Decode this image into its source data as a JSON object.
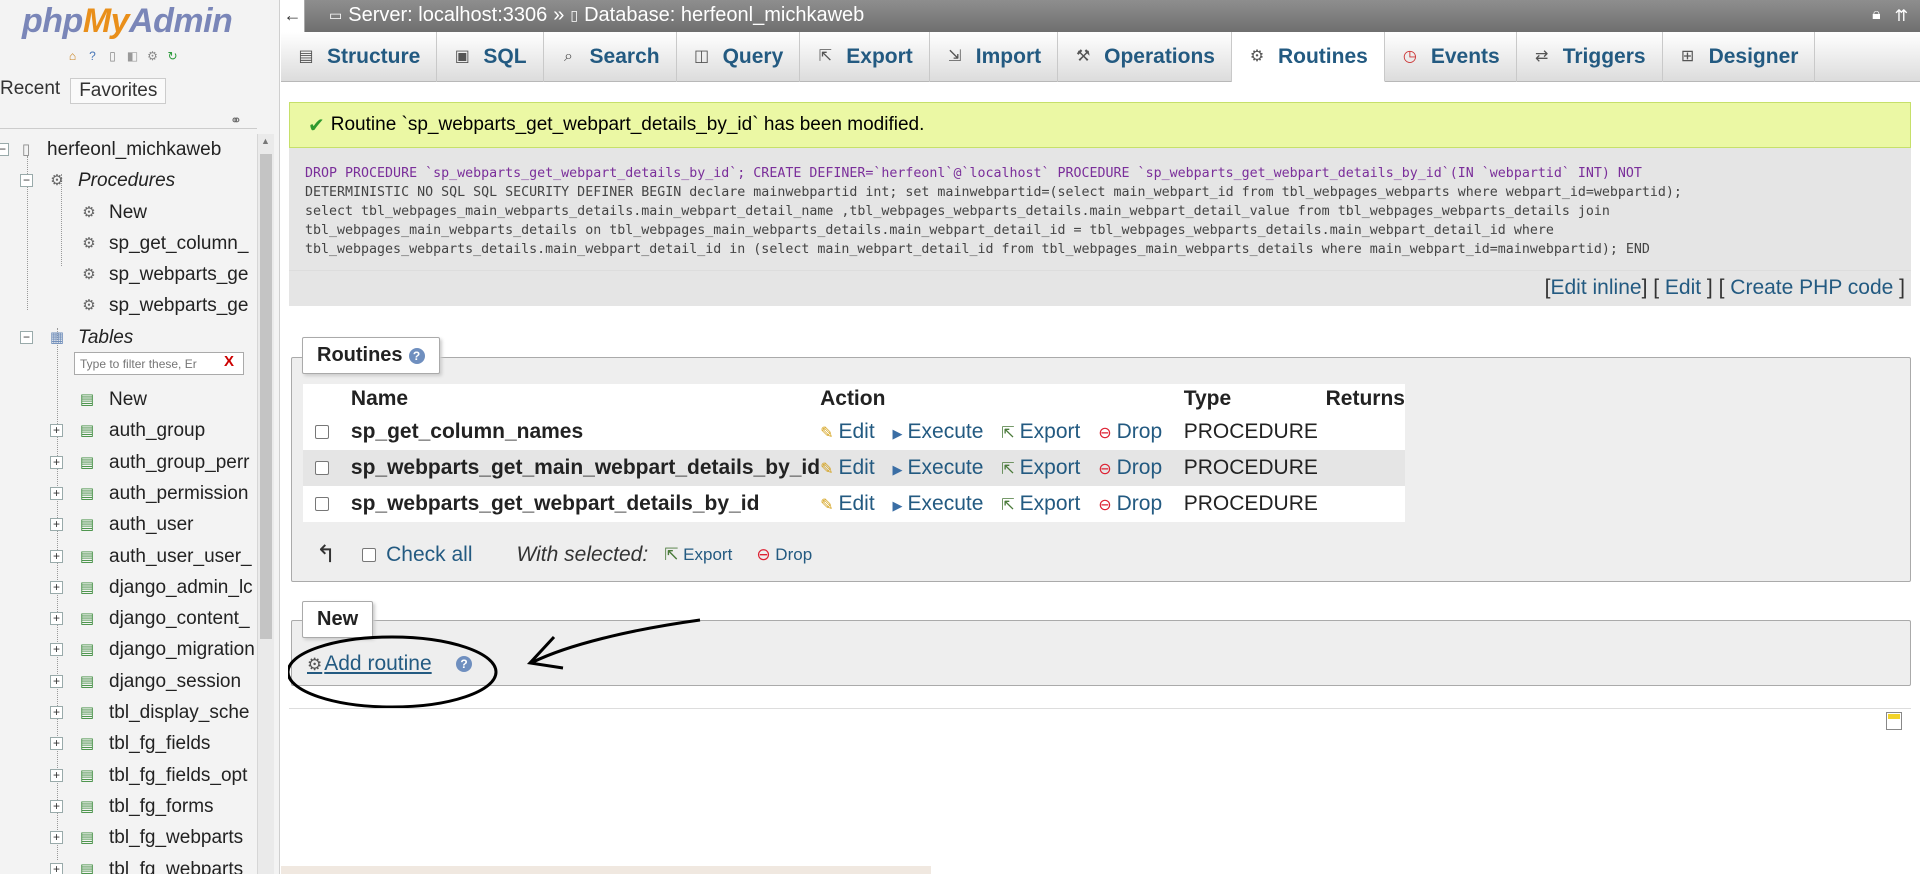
{
  "nav": {
    "logo": {
      "php": "php",
      "my": "My",
      "admin": "Admin"
    },
    "tabs": {
      "recent": "Recent",
      "favorites": "Favorites"
    },
    "db_name": "herfeonl_michkaweb",
    "procedures": {
      "label": "Procedures",
      "items": [
        "New",
        "sp_get_column_",
        "sp_webparts_ge",
        "sp_webparts_ge"
      ]
    },
    "tables": {
      "label": "Tables",
      "filter_placeholder": "Type to filter these, Er",
      "filter_clear": "X",
      "items": [
        "New",
        "auth_group",
        "auth_group_perr",
        "auth_permission",
        "auth_user",
        "auth_user_user_",
        "django_admin_lc",
        "django_content_",
        "django_migration",
        "django_session",
        "tbl_display_sche",
        "tbl_fg_fields",
        "tbl_fg_fields_opt",
        "tbl_fg_forms",
        "tbl_fg_webparts",
        "tbl_fg_webparts_"
      ]
    }
  },
  "topbar": {
    "server": "Server: localhost:3306",
    "sep": "»",
    "database": "Database: herfeonl_michkaweb"
  },
  "tabs": [
    {
      "label": "Structure",
      "icon": "structure-icon",
      "glyph": "▤"
    },
    {
      "label": "SQL",
      "icon": "sql-icon",
      "glyph": "▣"
    },
    {
      "label": "Search",
      "icon": "search-icon",
      "glyph": "⌕"
    },
    {
      "label": "Query",
      "icon": "query-icon",
      "glyph": "◫"
    },
    {
      "label": "Export",
      "icon": "export-icon",
      "glyph": "⇱"
    },
    {
      "label": "Import",
      "icon": "import-icon",
      "glyph": "⇲"
    },
    {
      "label": "Operations",
      "icon": "wrench-icon",
      "glyph": "⚒"
    },
    {
      "label": "Routines",
      "icon": "routines-icon",
      "glyph": "⚙"
    },
    {
      "label": "Events",
      "icon": "clock-icon",
      "glyph": "◷"
    },
    {
      "label": "Triggers",
      "icon": "triggers-icon",
      "glyph": "⇄"
    },
    {
      "label": "Designer",
      "icon": "designer-icon",
      "glyph": "⊞"
    }
  ],
  "message": "Routine `sp_webparts_get_webpart_details_by_id` has been modified.",
  "sql_lines": [
    "DROP PROCEDURE `sp_webparts_get_webpart_details_by_id`; CREATE DEFINER=`herfeonl`@`localhost` PROCEDURE `sp_webparts_get_webpart_details_by_id`(IN `webpartid` INT) NOT",
    "DETERMINISTIC NO SQL SQL SECURITY DEFINER BEGIN declare mainwebpartid int; set mainwebpartid=(select main_webpart_id from tbl_webpages_webparts where webpart_id=webpartid);",
    "select tbl_webpages_main_webparts_details.main_webpart_detail_name ,tbl_webpages_webparts_details.main_webpart_detail_value from tbl_webpages_webparts_details join",
    "tbl_webpages_main_webparts_details on tbl_webpages_main_webparts_details.main_webpart_detail_id = tbl_webpages_webparts_details.main_webpart_detail_id where",
    "tbl_webpages_webparts_details.main_webpart_detail_id in (select main_webpart_detail_id from tbl_webpages_main_webparts_details where main_webpart_id=mainwebpartid); END"
  ],
  "sql_actions": {
    "edit_inline": "Edit inline",
    "edit": "Edit",
    "create_php": "Create PHP code"
  },
  "routines": {
    "legend": "Routines",
    "headers": {
      "name": "Name",
      "action": "Action",
      "type": "Type",
      "returns": "Returns"
    },
    "rows": [
      {
        "name": "sp_get_column_names",
        "type": "PROCEDURE",
        "returns": ""
      },
      {
        "name": "sp_webparts_get_main_webpart_details_by_id",
        "type": "PROCEDURE",
        "returns": ""
      },
      {
        "name": "sp_webparts_get_webpart_details_by_id",
        "type": "PROCEDURE",
        "returns": ""
      }
    ],
    "actions": {
      "edit": "Edit",
      "execute": "Execute",
      "export": "Export",
      "drop": "Drop"
    },
    "check_all": "Check all",
    "with_selected": "With selected:",
    "bulk_export": "Export",
    "bulk_drop": "Drop"
  },
  "new": {
    "legend": "New",
    "add_routine": "Add routine"
  },
  "colors": {
    "link": "#235a81",
    "success_bg": "#ebf8a4",
    "sql_bg": "#e5e5e5"
  }
}
